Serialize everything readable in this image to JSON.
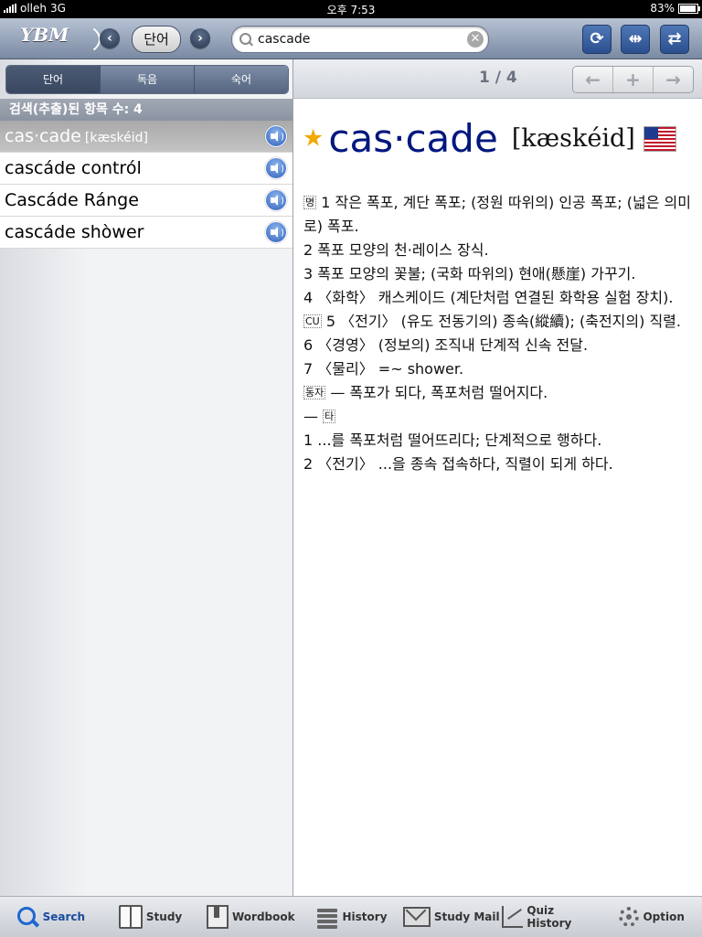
{
  "status": {
    "carrier": "olleh",
    "network": "3G",
    "time": "오후 7:53",
    "battery": "83%",
    "battery_level": 0.83
  },
  "toolbar": {
    "logo": "YBM",
    "back_icon": "chevron-left-icon",
    "mode_label": "단어",
    "forward_icon": "chevron-right-icon",
    "search_value": "cascade",
    "search_placeholder": "",
    "refresh_icon": "refresh-icon",
    "split_icon": "split-view-icon",
    "swap_icon": "swap-icon"
  },
  "left": {
    "segments": [
      "단어",
      "독음",
      "숙어"
    ],
    "selected_segment": 0,
    "result_count": "검색(추출)된 항목 수: 4",
    "results": [
      {
        "word": "cas·cade",
        "pron": "[kæskéid]",
        "selected": true
      },
      {
        "word": "cascáde contról",
        "pron": "",
        "selected": false
      },
      {
        "word": "Cascáde Ránge",
        "pron": "",
        "selected": false
      },
      {
        "word": "cascáde shòwer",
        "pron": "",
        "selected": false
      }
    ]
  },
  "right": {
    "pager": "1 / 4",
    "nav_buttons": [
      "←",
      "+",
      "→"
    ],
    "headword": "cas·cade",
    "pronunciation": "[kæskéid]",
    "accent_color": "#00177e",
    "definition_lines": [
      {
        "tag": "명",
        "text": "1 작은 폭포, 계단 폭포; (정원 따위의) 인공 폭포; (넓은 의미로) 폭포."
      },
      {
        "tag": "",
        "text": "2 폭포 모양의 천·레이스 장식."
      },
      {
        "tag": "",
        "text": "3 폭포 모양의 꽃불; (국화 따위의) 현애(懸崖) 가꾸기."
      },
      {
        "tag": "",
        "text": "4 〈화학〉 캐스케이드 (계단처럼 연결된 화학용 실험 장치)."
      },
      {
        "tag": "CU",
        "text": "5 〈전기〉 (유도 전동기의) 종속(縱續); (축전지의) 직렬."
      },
      {
        "tag": "",
        "text": "6 〈경영〉 (정보의) 조직내 단계적 신속 전달."
      },
      {
        "tag": "",
        "text": "7 〈물리〉 =~ shower."
      },
      {
        "tag": "동자",
        "text": "— 폭포가 되다, 폭포처럼 떨어지다."
      },
      {
        "tag": "타",
        "text": "—"
      },
      {
        "tag": "",
        "text": "1 ...를 폭포처럼 떨어뜨리다; 단계적으로 행하다."
      },
      {
        "tag": "",
        "text": "2 〈전기〉 ...을 종속 접속하다, 직렬이 되게 하다."
      }
    ]
  },
  "tabs": [
    {
      "label": "Search",
      "icon": "search-icon",
      "active": true
    },
    {
      "label": "Study",
      "icon": "book-icon",
      "active": false
    },
    {
      "label": "Wordbook",
      "icon": "wordbook-icon",
      "active": false
    },
    {
      "label": "History",
      "icon": "history-icon",
      "active": false
    },
    {
      "label": "Study Mail",
      "icon": "mail-icon",
      "active": false
    },
    {
      "label": "Quiz History",
      "icon": "chart-icon",
      "active": false
    },
    {
      "label": "Option",
      "icon": "gear-icon",
      "active": false
    }
  ]
}
